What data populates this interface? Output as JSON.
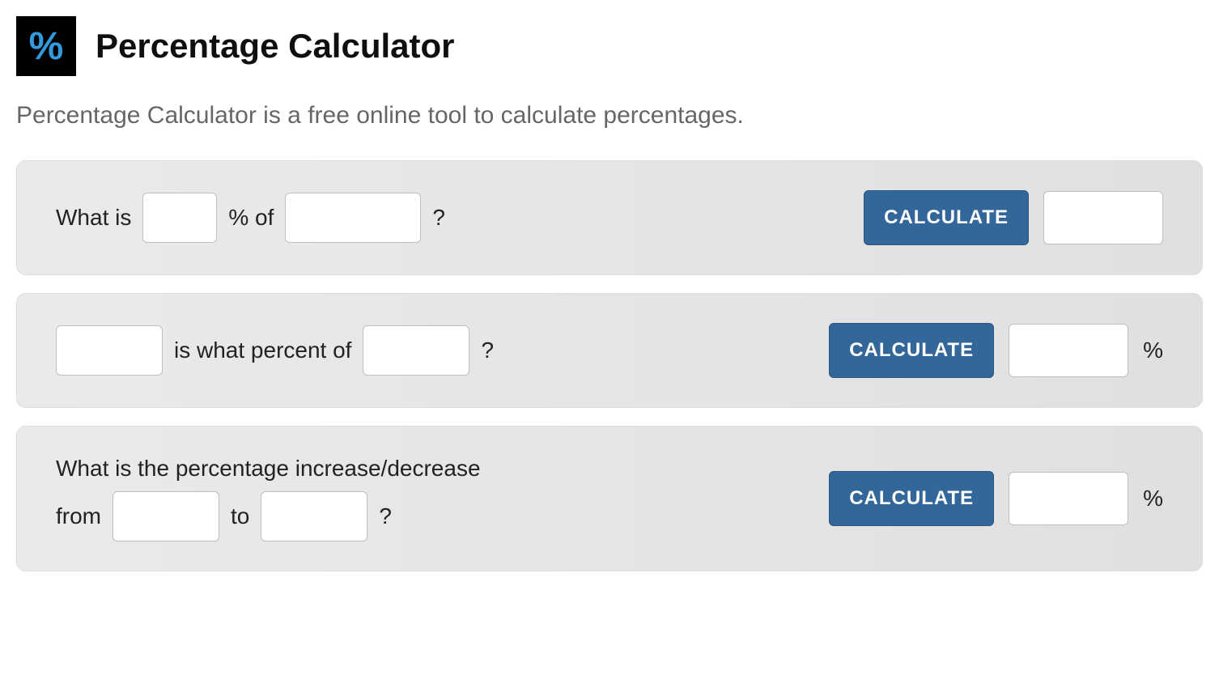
{
  "header": {
    "logo_symbol": "%",
    "title": "Percentage Calculator"
  },
  "description": "Percentage Calculator is a free online tool to calculate percentages.",
  "calculators": {
    "percent_of": {
      "text_before": "What is",
      "text_mid": "% of",
      "text_after": "?",
      "button_label": "CALCULATE",
      "input1_value": "",
      "input2_value": "",
      "result_value": ""
    },
    "is_what_percent": {
      "text_mid": "is what percent of",
      "text_after": "?",
      "button_label": "CALCULATE",
      "result_suffix": "%",
      "input1_value": "",
      "input2_value": "",
      "result_value": ""
    },
    "increase_decrease": {
      "heading": "What is the percentage increase/decrease",
      "text_from": "from",
      "text_to": "to",
      "text_after": "?",
      "button_label": "CALCULATE",
      "result_suffix": "%",
      "input1_value": "",
      "input2_value": "",
      "result_value": ""
    }
  }
}
